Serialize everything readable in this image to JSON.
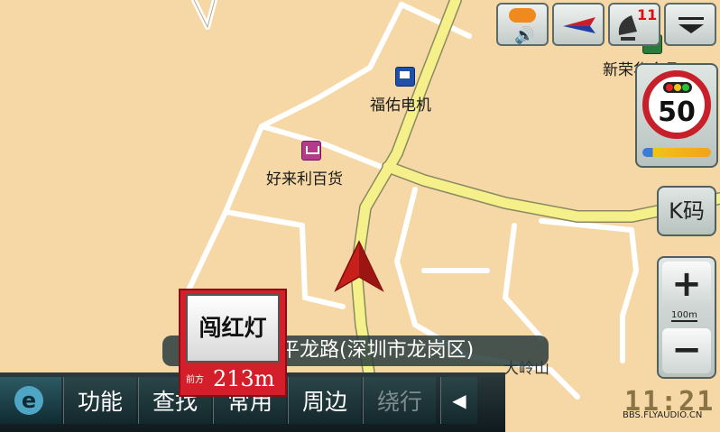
{
  "map": {
    "pois": [
      {
        "name": "福佑电机",
        "icon": "computer-store-icon"
      },
      {
        "name": "好来利百货",
        "icon": "shopping-cart-icon"
      },
      {
        "name": "新荣华食品",
        "icon": "food-icon"
      }
    ],
    "place_label": "大岭山"
  },
  "top_buttons": [
    {
      "name": "voice-button",
      "icon": "speech-bubble-speaker-icon"
    },
    {
      "name": "compass-button",
      "icon": "compass-arrow-icon"
    },
    {
      "name": "gps-button",
      "icon": "satellite-dish-icon",
      "count": "11"
    },
    {
      "name": "menu-toggle-button",
      "icon": "chevron-down-icon"
    }
  ],
  "speed_limit": {
    "value": "50",
    "icon": "traffic-light-icon"
  },
  "k_button": {
    "label": "K码"
  },
  "zoom": {
    "plus": "+",
    "minus": "−",
    "scale": "100m"
  },
  "street_name": "平龙路(深圳市龙岗区)",
  "alert": {
    "title": "闯红灯",
    "prefix": "前方",
    "distance": "213m"
  },
  "bottom_menu": {
    "tabs": [
      "功能",
      "查找",
      "常用",
      "周边",
      "绕行"
    ],
    "back": "◀"
  },
  "clock": "11:21",
  "watermark": "BBS.FLYAUDIO.CN",
  "colors": {
    "map_bg": "#f6d8a6",
    "main_road": "#f6f08a",
    "alert_red": "#d41e2a"
  }
}
